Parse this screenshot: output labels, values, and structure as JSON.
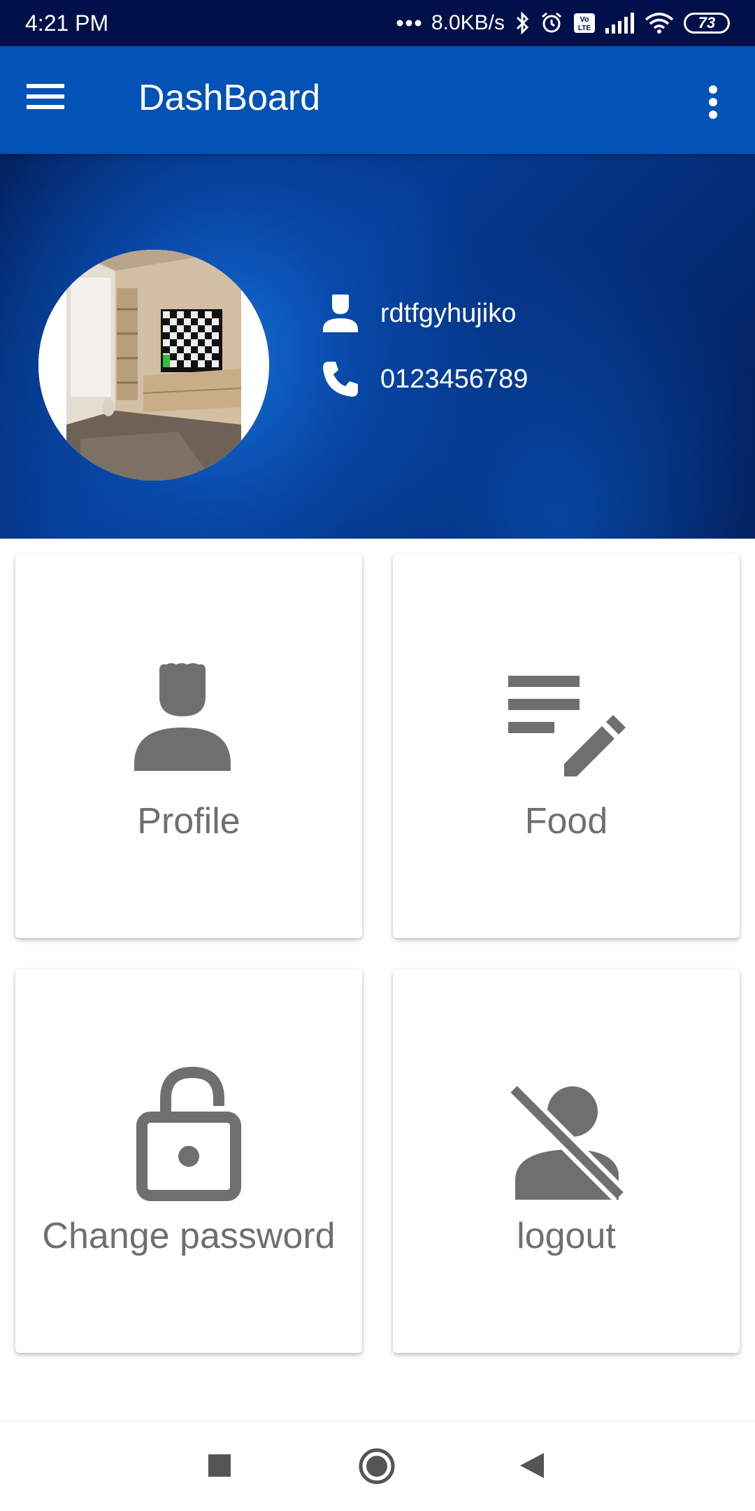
{
  "status_bar": {
    "time": "4:21 PM",
    "network_speed": "8.0KB/s",
    "volte": "Vo LTE",
    "battery": "73",
    "icons": [
      "more-dots-icon",
      "bluetooth-icon",
      "alarm-icon",
      "volte-icon",
      "signal-icon",
      "wifi-icon",
      "battery-icon"
    ]
  },
  "app_bar": {
    "title": "DashBoard",
    "color": "#0352b5",
    "icons": [
      "menu-icon",
      "more-vert-icon"
    ]
  },
  "header": {
    "username": "rdtfgyhujiko",
    "phone": "0123456789",
    "icons": [
      "person-icon",
      "phone-icon"
    ]
  },
  "cards": [
    {
      "label": "Profile",
      "icon": "person-icon"
    },
    {
      "label": "Food",
      "icon": "edit-note-icon"
    },
    {
      "label": "Change password",
      "icon": "lock-open-icon"
    },
    {
      "label": "logout",
      "icon": "person-off-icon"
    }
  ],
  "colors": {
    "status_bar": "#02104a",
    "card_icon": "#6f6f6f"
  },
  "nav_bar": {
    "icons": [
      "square-recents-icon",
      "circle-home-icon",
      "triangle-back-icon"
    ]
  }
}
